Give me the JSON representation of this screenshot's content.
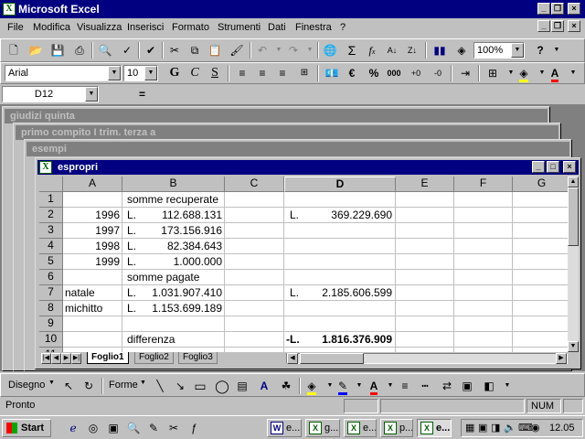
{
  "app": {
    "title": "Microsoft Excel"
  },
  "menu": [
    "File",
    "Modifica",
    "Visualizza",
    "Inserisci",
    "Formato",
    "Strumenti",
    "Dati",
    "Finestra",
    "?"
  ],
  "toolbar": {
    "zoom": "100%",
    "font_name": "Arial",
    "font_size": "10",
    "euro_symbol": "€",
    "percent_symbol": "%",
    "thousands_symbol": "000"
  },
  "formula_bar": {
    "name_box": "D12",
    "equals": "=",
    "content": ""
  },
  "background_windows": [
    {
      "title": "giudizi quinta"
    },
    {
      "title": "primo compito I trim. terza a"
    },
    {
      "title": "esempi"
    }
  ],
  "workbook": {
    "title": "espropri",
    "columns": [
      "A",
      "B",
      "C",
      "D",
      "E",
      "F",
      "G"
    ],
    "rows": [
      "1",
      "2",
      "3",
      "4",
      "5",
      "6",
      "7",
      "8",
      "9",
      "10",
      "11"
    ],
    "cells": {
      "B1": "somme recuperate",
      "A2": "1996",
      "B2_cur": "L.",
      "B2": "112.688.131",
      "D2_cur": "L.",
      "D2": "369.229.690",
      "A3": "1997",
      "B3_cur": "L.",
      "B3": "173.156.916",
      "A4": "1998",
      "B4_cur": "L.",
      "B4": "82.384.643",
      "A5": "1999",
      "B5_cur": "L.",
      "B5": "1.000.000",
      "B6": "somme pagate",
      "A7": "natale",
      "B7_cur": "L.",
      "B7": "1.031.907.410",
      "D7_cur": "L.",
      "D7": "2.185.606.599",
      "A8": "michitto",
      "B8_cur": "L.",
      "B8": "1.153.699.189",
      "B10": "differenza",
      "D10_cur": "-L.",
      "D10": "1.816.376.909"
    },
    "sheets": [
      "Foglio1",
      "Foglio2",
      "Foglio3"
    ],
    "active_sheet": "Foglio1"
  },
  "drawing_toolbar": {
    "disegno": "Disegno",
    "forme": "Forme"
  },
  "status": {
    "text": "Pronto",
    "num": "NUM"
  },
  "taskbar": {
    "start": "Start",
    "tasks": [
      "e...",
      "g...",
      "e...",
      "p...",
      "e..."
    ],
    "clock": "12.05"
  },
  "colors": {
    "title_active": "#000080",
    "title_inactive": "#808080",
    "face": "#c0c0c0",
    "excel_green": "#006000"
  }
}
